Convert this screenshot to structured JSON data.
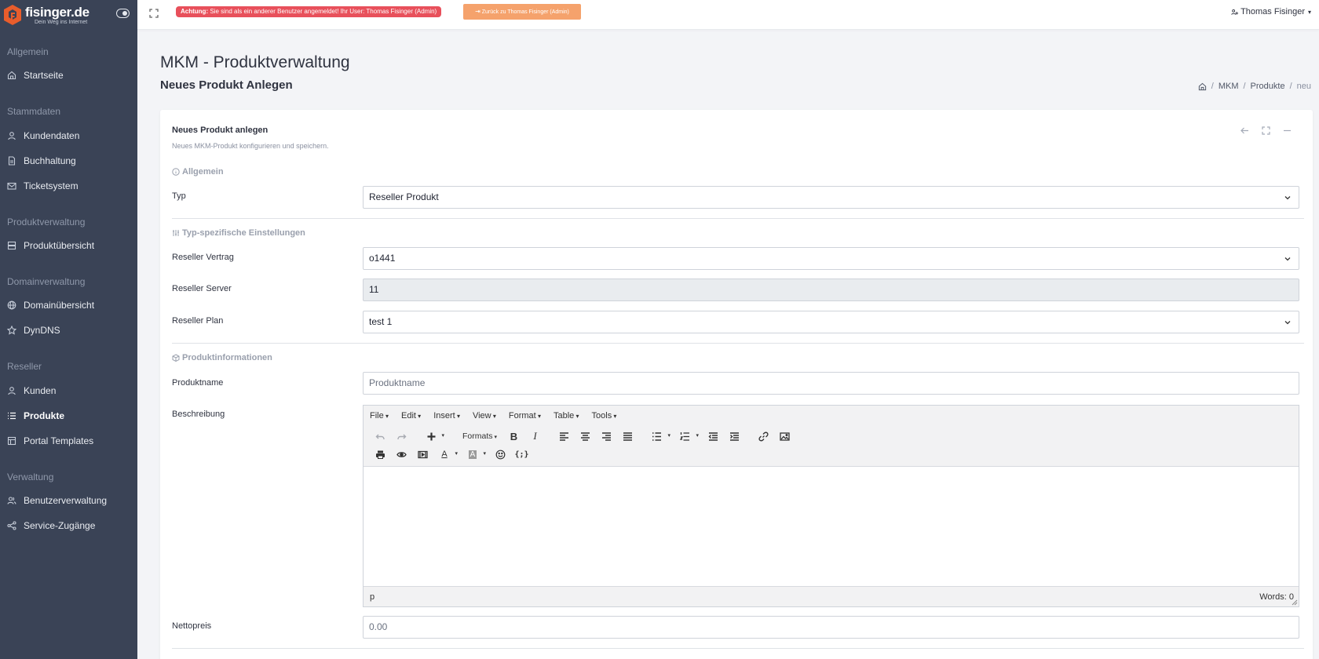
{
  "brand": {
    "name": "fisinger.de",
    "tagline": "Dein Weg ins Internet"
  },
  "sidebar": {
    "sections": [
      {
        "title": "Allgemein",
        "items": [
          {
            "label": "Startseite",
            "icon": "home-icon"
          }
        ]
      },
      {
        "title": "Stammdaten",
        "items": [
          {
            "label": "Kundendaten",
            "icon": "user-icon"
          },
          {
            "label": "Buchhaltung",
            "icon": "document-icon"
          },
          {
            "label": "Ticketsystem",
            "icon": "mail-icon"
          }
        ]
      },
      {
        "title": "Produktverwaltung",
        "items": [
          {
            "label": "Produktübersicht",
            "icon": "server-icon"
          }
        ]
      },
      {
        "title": "Domainverwaltung",
        "items": [
          {
            "label": "Domainübersicht",
            "icon": "globe-icon"
          },
          {
            "label": "DynDNS",
            "icon": "star-icon"
          }
        ]
      },
      {
        "title": "Reseller",
        "items": [
          {
            "label": "Kunden",
            "icon": "user-icon"
          },
          {
            "label": "Produkte",
            "icon": "list-icon",
            "active": true
          },
          {
            "label": "Portal Templates",
            "icon": "layout-icon"
          }
        ]
      },
      {
        "title": "Verwaltung",
        "items": [
          {
            "label": "Benutzerverwaltung",
            "icon": "users-icon"
          },
          {
            "label": "Service-Zugänge",
            "icon": "share-icon"
          }
        ]
      }
    ]
  },
  "topbar": {
    "alert_strong": "Achtung:",
    "alert_text": "Sie sind als ein anderer Benutzer angemeldet! Ihr User: Thomas Fisinger (Admin)",
    "back_button": "Zurück zu Thomas Fisinger (Admin)",
    "user_name": "Thomas Fisinger"
  },
  "page": {
    "title": "MKM - Produktverwaltung",
    "subtitle": "Neues Produkt Anlegen",
    "breadcrumb": [
      "MKM",
      "Produkte",
      "neu"
    ]
  },
  "card": {
    "title": "Neues Produkt anlegen",
    "description": "Neues MKM-Produkt konfigurieren und speichern."
  },
  "form": {
    "section_general": "Allgemein",
    "type_label": "Typ",
    "type_value": "Reseller Produkt",
    "section_type_settings": "Typ-spezifische Einstellungen",
    "reseller_contract_label": "Reseller Vertrag",
    "reseller_contract_value": "o1441",
    "reseller_server_label": "Reseller Server",
    "reseller_server_value": "11",
    "reseller_plan_label": "Reseller Plan",
    "reseller_plan_value": "test 1",
    "section_product_info": "Produktinformationen",
    "product_name_label": "Produktname",
    "product_name_placeholder": "Produktname",
    "description_label": "Beschreibung",
    "net_price_label": "Nettopreis",
    "net_price_placeholder": "0.00"
  },
  "editor": {
    "menus": [
      "File",
      "Edit",
      "Insert",
      "View",
      "Format",
      "Table",
      "Tools"
    ],
    "formats_label": "Formats",
    "status_path": "p",
    "word_count": "Words: 0"
  }
}
